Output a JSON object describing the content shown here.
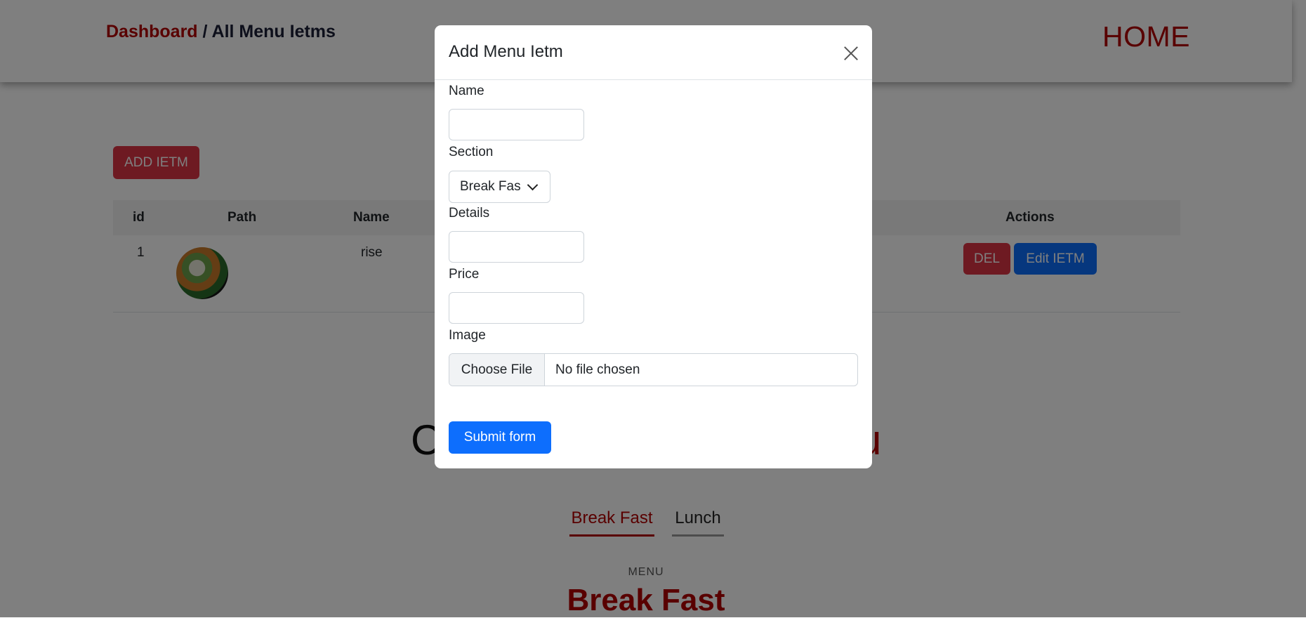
{
  "page": {
    "breadcrumb": {
      "link": "Dashboard",
      "separator": " / ",
      "current": "All Menu Ietms"
    },
    "home_link": "HOME",
    "add_button": "ADD IETM",
    "table": {
      "headers": [
        "id",
        "Path",
        "Name",
        "Actions"
      ],
      "rows": [
        {
          "id": "1",
          "name": "rise",
          "delete_label": "DEL",
          "edit_label": "Edit IETM"
        }
      ]
    },
    "heading_left_fragment": "C",
    "heading_right_fragment": "u",
    "tabs": [
      {
        "label": "Break Fast",
        "active": true
      },
      {
        "label": "Lunch",
        "active": false
      }
    ],
    "menu_kicker": "MENU",
    "menu_title": "Break Fast"
  },
  "modal": {
    "title": "Add Menu Ietm",
    "fields": {
      "name_label": "Name",
      "name_value": "",
      "section_label": "Section",
      "section_value": "Break Fast",
      "details_label": "Details",
      "details_value": "",
      "price_label": "Price",
      "price_value": "",
      "image_label": "Image",
      "file_button": "Choose File",
      "file_status": "No file chosen"
    },
    "submit_label": "Submit form"
  },
  "colors": {
    "brand_red": "#b30000",
    "danger": "#dc3545",
    "primary": "#0d6efd",
    "backdrop": "rgba(0,0,0,0.5)"
  }
}
